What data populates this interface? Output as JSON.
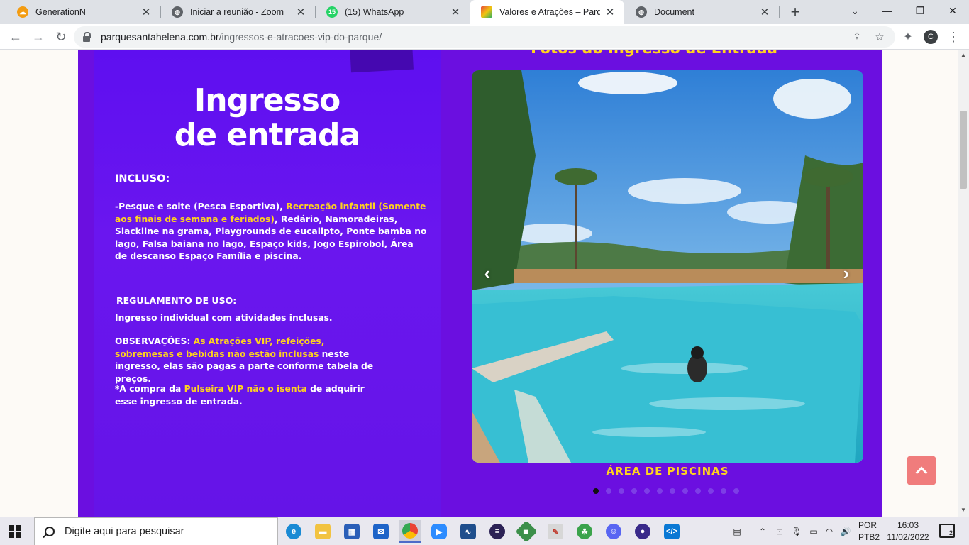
{
  "browser": {
    "tabs": [
      {
        "title": "GenerationN",
        "icon": "cloud-icon",
        "color": "#f39c12",
        "active": false
      },
      {
        "title": "Iniciar a reunião - Zoom",
        "icon": "globe-icon",
        "color": "#5f6368",
        "active": false
      },
      {
        "title": "(15) WhatsApp",
        "icon": "whatsapp-icon",
        "color": "#25d366",
        "badge": "15",
        "active": false
      },
      {
        "title": "Valores e Atrações – Parque S",
        "icon": "park-icon",
        "color": "#d35400",
        "active": true
      },
      {
        "title": "Document",
        "icon": "globe-icon",
        "color": "#5f6368",
        "active": false
      }
    ],
    "url_host": "parquesantahelena.com.br",
    "url_path": "/ingressos-e-atracoes-vip-do-parque/",
    "profile_initial": "C"
  },
  "page": {
    "promo": {
      "heading_line1": "Ingresso",
      "heading_line2": "de entrada",
      "included_title": "INCLUSO:",
      "included_text_1": "-Pesque e solte ",
      "included_text_2": "(Pesca Esportiva)",
      "included_text_3": ", ",
      "included_hl_1": "Recreação infantil",
      "included_hl_2": "(Somente aos finais de semana e feriados)",
      "included_text_4": ", Redário, Namoradeiras, Slackline na grama, Playgrounds de eucalipto, Ponte bamba no lago, Falsa baiana no lago, Espaço kids, Jogo Espirobol, Área de descanso ",
      "included_text_5": "Espaço Família",
      "included_text_6": " e piscina.",
      "rules_title": "REGULAMENTO DE USO:",
      "rules_text": "Ingresso individual com atividades inclusas.",
      "obs_label": "OBSERVAÇÕES: ",
      "obs_hl_1": "As Atrações VIP, refeições, sobremesas e bebidas não estão inclusas",
      "obs_text": " neste ingresso, elas são pagas a parte conforme tabela de preços.",
      "note_1": "*A compra da ",
      "note_hl_1": "Pulseira VIP",
      "note_2": " ",
      "note_hl_2": "não o isenta",
      "note_3": " de adquirir esse ingresso de entrada."
    },
    "gallery": {
      "title": "Fotos do Ingresso de Entrada",
      "caption": "ÁREA DE PISCINAS",
      "slide_count": 12,
      "active_slide": 0
    }
  },
  "taskbar": {
    "search_placeholder": "Digite aqui para pesquisar",
    "apps": [
      "edge-icon",
      "file-explorer-icon",
      "store-icon",
      "mail-icon",
      "chrome-icon",
      "zoom-icon",
      "wireshark-icon",
      "eclipse-icon",
      "git-icon",
      "paint-icon",
      "android-studio-icon",
      "discord-icon",
      "eclipse-ide-icon",
      "vscode-icon"
    ],
    "lang_line1": "POR",
    "lang_line2": "PTB2",
    "time": "16:03",
    "date": "11/02/2022",
    "notifications": "2"
  },
  "colors": {
    "page_purple": "#6b0fe0",
    "highlight_yellow": "#ffd21f",
    "back_to_top": "#f07c7c"
  }
}
